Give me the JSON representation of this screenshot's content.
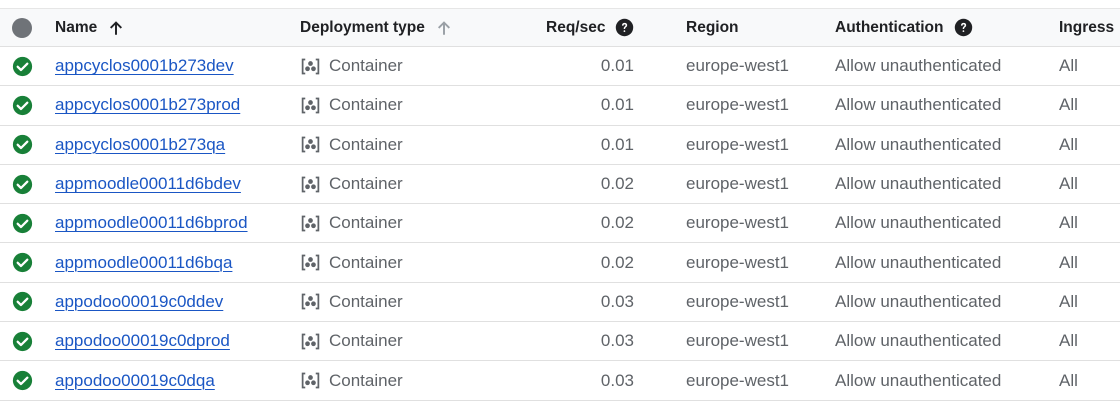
{
  "columns": {
    "name": "Name",
    "deployment_type": "Deployment type",
    "req_sec": "Req/sec",
    "region": "Region",
    "authentication": "Authentication",
    "ingress": "Ingress"
  },
  "colors": {
    "status_ok": "#188038",
    "link": "#1a56c4",
    "header_bg": "#f8f9fa"
  },
  "rows": [
    {
      "name": "appcyclos0001b273dev",
      "type": "Container",
      "req": "0.01",
      "region": "europe-west1",
      "auth": "Allow unauthenticated",
      "ingress": "All"
    },
    {
      "name": "appcyclos0001b273prod",
      "type": "Container",
      "req": "0.01",
      "region": "europe-west1",
      "auth": "Allow unauthenticated",
      "ingress": "All"
    },
    {
      "name": "appcyclos0001b273qa",
      "type": "Container",
      "req": "0.01",
      "region": "europe-west1",
      "auth": "Allow unauthenticated",
      "ingress": "All"
    },
    {
      "name": "appmoodle00011d6bdev",
      "type": "Container",
      "req": "0.02",
      "region": "europe-west1",
      "auth": "Allow unauthenticated",
      "ingress": "All"
    },
    {
      "name": "appmoodle00011d6bprod",
      "type": "Container",
      "req": "0.02",
      "region": "europe-west1",
      "auth": "Allow unauthenticated",
      "ingress": "All"
    },
    {
      "name": "appmoodle00011d6bqa",
      "type": "Container",
      "req": "0.02",
      "region": "europe-west1",
      "auth": "Allow unauthenticated",
      "ingress": "All"
    },
    {
      "name": "appodoo00019c0ddev",
      "type": "Container",
      "req": "0.03",
      "region": "europe-west1",
      "auth": "Allow unauthenticated",
      "ingress": "All"
    },
    {
      "name": "appodoo00019c0dprod",
      "type": "Container",
      "req": "0.03",
      "region": "europe-west1",
      "auth": "Allow unauthenticated",
      "ingress": "All"
    },
    {
      "name": "appodoo00019c0dqa",
      "type": "Container",
      "req": "0.03",
      "region": "europe-west1",
      "auth": "Allow unauthenticated",
      "ingress": "All"
    }
  ]
}
